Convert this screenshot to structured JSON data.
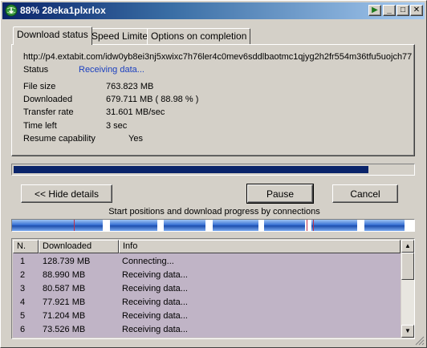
{
  "window": {
    "title": "88% 28eka1plxrlox",
    "controls": {
      "extra": "▶",
      "minimize": "_",
      "maximize": "□",
      "close": "✕"
    }
  },
  "tabs": [
    {
      "label": "Download status",
      "active": true
    },
    {
      "label": "Speed Limiter",
      "active": false
    },
    {
      "label": "Options on completion",
      "active": false
    }
  ],
  "details": {
    "url": "http://p4.extabit.com/idw0yb8ei3nj5xwixc7h76ler4c0mev6sddlbaotmc1qjyg2h2fr554m36tfu5uojch77",
    "status_label": "Status",
    "status_value": "Receiving data...",
    "file_size_label": "File size",
    "file_size_value": "763.823  MB",
    "downloaded_label": "Downloaded",
    "downloaded_value": "679.711  MB  ( 88.98 % )",
    "transfer_rate_label": "Transfer rate",
    "transfer_rate_value": "31.601  MB/sec",
    "time_left_label": "Time left",
    "time_left_value": "3 sec",
    "resume_label": "Resume capability",
    "resume_value": "Yes"
  },
  "progress": {
    "fraction": 0.8898
  },
  "buttons": {
    "hide_details": "<< Hide details",
    "pause": "Pause",
    "cancel": "Cancel"
  },
  "connections": {
    "caption": "Start positions and download progress by connections"
  },
  "table": {
    "headers": {
      "n": "N.",
      "downloaded": "Downloaded",
      "info": "Info"
    },
    "rows": [
      {
        "n": "1",
        "downloaded": "128.739  MB",
        "info": "Connecting..."
      },
      {
        "n": "2",
        "downloaded": "88.990  MB",
        "info": "Receiving data..."
      },
      {
        "n": "3",
        "downloaded": "80.587  MB",
        "info": "Receiving data..."
      },
      {
        "n": "4",
        "downloaded": "77.921  MB",
        "info": "Receiving data..."
      },
      {
        "n": "5",
        "downloaded": "71.204  MB",
        "info": "Receiving data..."
      },
      {
        "n": "6",
        "downloaded": "73.526  MB",
        "info": "Receiving data..."
      }
    ]
  },
  "colors": {
    "titlebar_start": "#0a246a",
    "progress": "#0a246a",
    "status_text": "#1a3fbf",
    "list_background": "#c0b4c6"
  },
  "icons": {
    "app": "globe-download-icon",
    "scroll_up": "arrow-up-icon",
    "scroll_down": "arrow-down-icon"
  }
}
